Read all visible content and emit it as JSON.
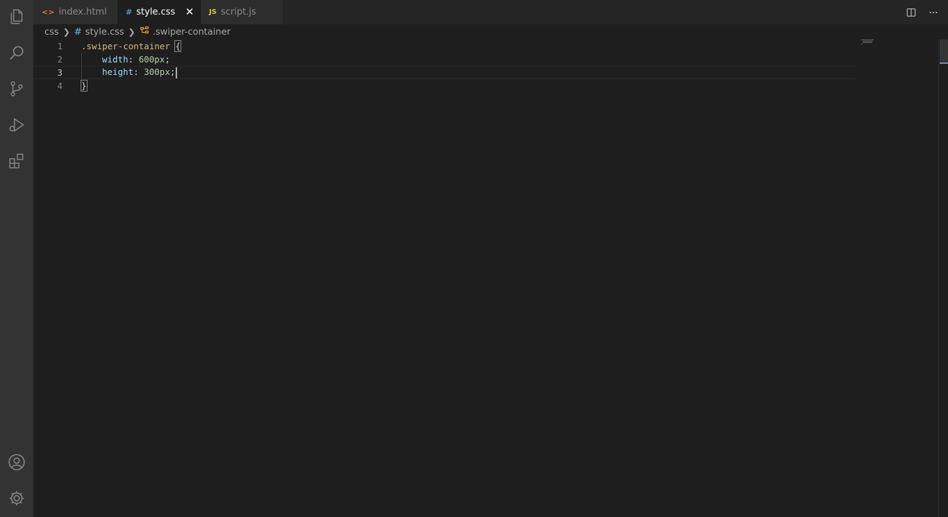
{
  "tabs": [
    {
      "icon": "<>",
      "label": "index.html",
      "icon_color": "#e37933"
    },
    {
      "icon": "#",
      "label": "style.css",
      "icon_color": "#519aba",
      "active": true,
      "close": "✕"
    },
    {
      "icon": "JS",
      "label": "script.js",
      "icon_color": "#cbcb41"
    }
  ],
  "breadcrumb": {
    "folder": "css",
    "file_icon": "#",
    "file": "style.css",
    "symbol": ".swiper-container"
  },
  "editor": {
    "line_numbers": [
      "1",
      "2",
      "3",
      "4"
    ],
    "lines": {
      "l1": {
        "selector": ".swiper-container",
        "brace": "{"
      },
      "l2": {
        "prop": "width",
        "colon": ": ",
        "value": "600px",
        "semi": ";"
      },
      "l3": {
        "prop": "height",
        "colon": ": ",
        "value": "300px",
        "semi": ";"
      },
      "l4": {
        "brace": "}"
      }
    },
    "active_line": 3
  },
  "colors": {
    "activity_bar": "#333333",
    "editor_bg": "#1e1e1e",
    "selector": "#d7ba7d",
    "property": "#9cdcfe",
    "number": "#b5cea8"
  },
  "icons": {
    "activity": [
      "explorer-icon",
      "search-icon",
      "source-control-icon",
      "run-debug-icon",
      "extensions-icon",
      "account-icon",
      "settings-gear-icon"
    ],
    "tab_actions": [
      "split-editor-icon",
      "more-actions-icon"
    ]
  }
}
